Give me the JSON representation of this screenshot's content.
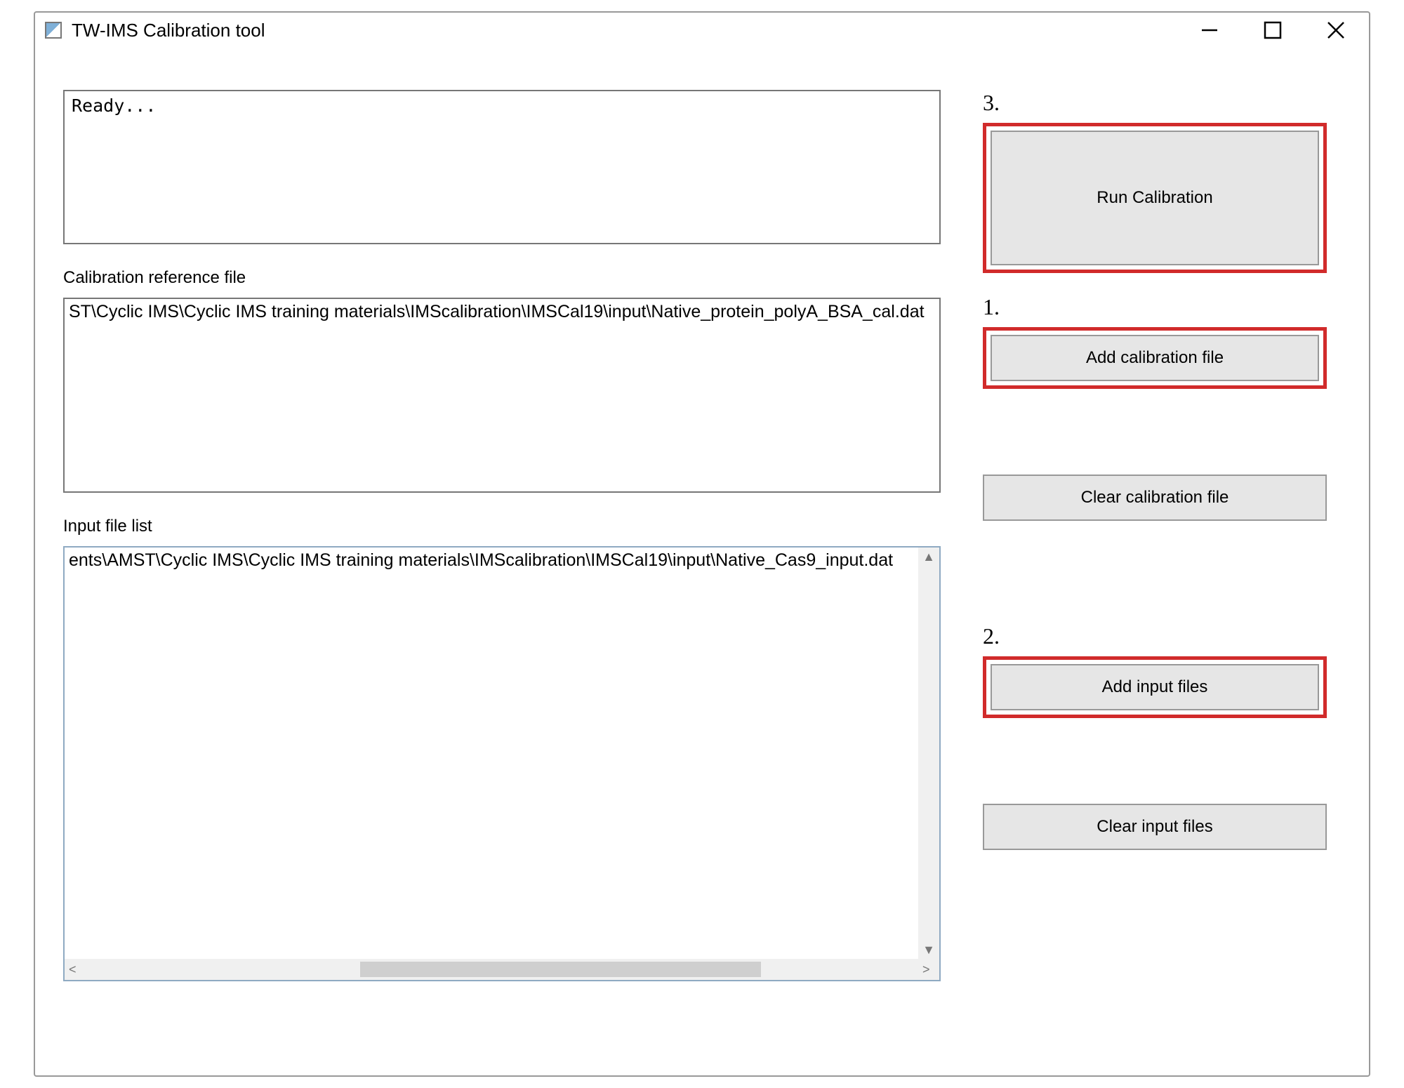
{
  "window": {
    "title": "TW-IMS Calibration tool"
  },
  "status": {
    "text": "Ready..."
  },
  "labels": {
    "calref": "Calibration reference file",
    "inputlist": "Input file list"
  },
  "calref": {
    "path": "ST\\Cyclic IMS\\Cyclic IMS training materials\\IMScalibration\\IMSCal19\\input\\Native_protein_polyA_BSA_cal.dat"
  },
  "inputlist": {
    "items": [
      "ents\\AMST\\Cyclic IMS\\Cyclic IMS training materials\\IMScalibration\\IMSCal19\\input\\Native_Cas9_input.dat"
    ]
  },
  "buttons": {
    "run": "Run Calibration",
    "add_cal": "Add calibration file",
    "clear_cal": "Clear calibration file",
    "add_input": "Add input files",
    "clear_input": "Clear input files"
  },
  "annotations": {
    "step1": "1.",
    "step2": "2.",
    "step3": "3."
  }
}
